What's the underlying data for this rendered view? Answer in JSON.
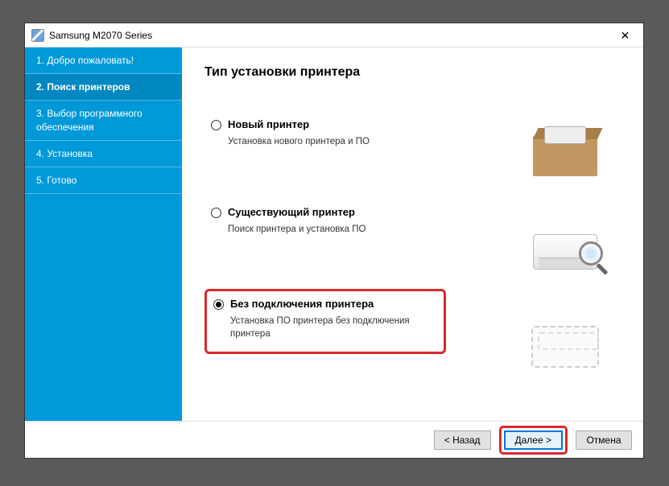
{
  "window": {
    "title": "Samsung M2070 Series",
    "close_symbol": "✕"
  },
  "sidebar": {
    "steps": [
      {
        "label": "1. Добро пожаловать!"
      },
      {
        "label": "2. Поиск принтеров"
      },
      {
        "label": "3. Выбор программного обеспечения"
      },
      {
        "label": "4. Установка"
      },
      {
        "label": "5. Готово"
      }
    ],
    "active_index": 1
  },
  "main": {
    "heading": "Тип установки принтера",
    "options": [
      {
        "title": "Новый принтер",
        "desc": "Установка нового принтера и ПО",
        "selected": false
      },
      {
        "title": "Существующий принтер",
        "desc": "Поиск принтера и установка ПО",
        "selected": false
      },
      {
        "title": "Без подключения принтера",
        "desc": "Установка ПО принтера без подключения принтера",
        "selected": true
      }
    ]
  },
  "footer": {
    "back": "< Назад",
    "next": "Далее >",
    "cancel": "Отмена"
  }
}
